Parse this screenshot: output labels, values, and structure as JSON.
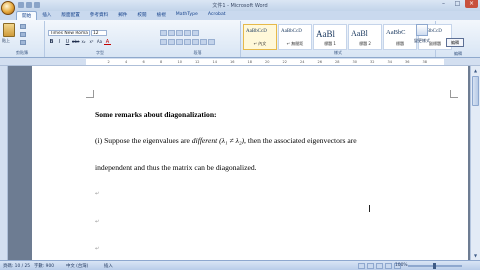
{
  "window": {
    "title": "文件1 - Microsoft Word",
    "controls": [
      "–",
      "□",
      "×"
    ]
  },
  "ribbon": {
    "tabs": [
      "開始",
      "插入",
      "版面配置",
      "參考資料",
      "郵件",
      "校閱",
      "檢視",
      "MathType",
      "Acrobat"
    ],
    "paste_label": "貼上",
    "font_name": "Times New Roma",
    "font_size": "12",
    "format_buttons": [
      "B",
      "I",
      "U",
      "abe",
      "x₂",
      "x²",
      "Aa",
      "A"
    ],
    "group_labels": {
      "clipboard": "剪貼簿",
      "font": "字型",
      "paragraph": "段落",
      "styles": "樣式",
      "edit": "編輯"
    },
    "styles": [
      {
        "sample": "AaBbCcD",
        "name": "↵ 內文",
        "size": "5px"
      },
      {
        "sample": "AaBbCcD",
        "name": "↵ 無間距",
        "size": "5px"
      },
      {
        "sample": "AaBl",
        "name": "標題 1",
        "size": "9px"
      },
      {
        "sample": "AaBl",
        "name": "標題 2",
        "size": "8px"
      },
      {
        "sample": "AaBbC",
        "name": "標題",
        "size": "6.5px"
      },
      {
        "sample": "AaBbCcD",
        "name": "副標題",
        "size": "5px"
      }
    ],
    "change_styles_label": "變更樣式",
    "edit_tooltip": "編輯"
  },
  "ruler": {
    "ticks": [
      "2",
      "4",
      "6",
      "8",
      "10",
      "12",
      "14",
      "16",
      "18",
      "20",
      "22",
      "24",
      "26",
      "28",
      "30",
      "32",
      "34",
      "36",
      "38"
    ]
  },
  "document": {
    "heading": "Some remarks about diagonalization:",
    "para1_before": "(i) Suppose the eigenvalues  are ",
    "para1_italic": "different",
    "para1_math": " (λ₁ ≠ λ₂)",
    "para1_after": ", then the associated  eigenvectors  are",
    "para2": "independent and thus the matrix can be diagonalized.",
    "para_marks": [
      "↵",
      "↵",
      "↵"
    ]
  },
  "statusbar": {
    "page": "頁碼: 10 / 25",
    "words": "字數: 900",
    "lang_icon": "中文 (台灣)",
    "insert_mode": "插入",
    "zoom": "100%"
  }
}
